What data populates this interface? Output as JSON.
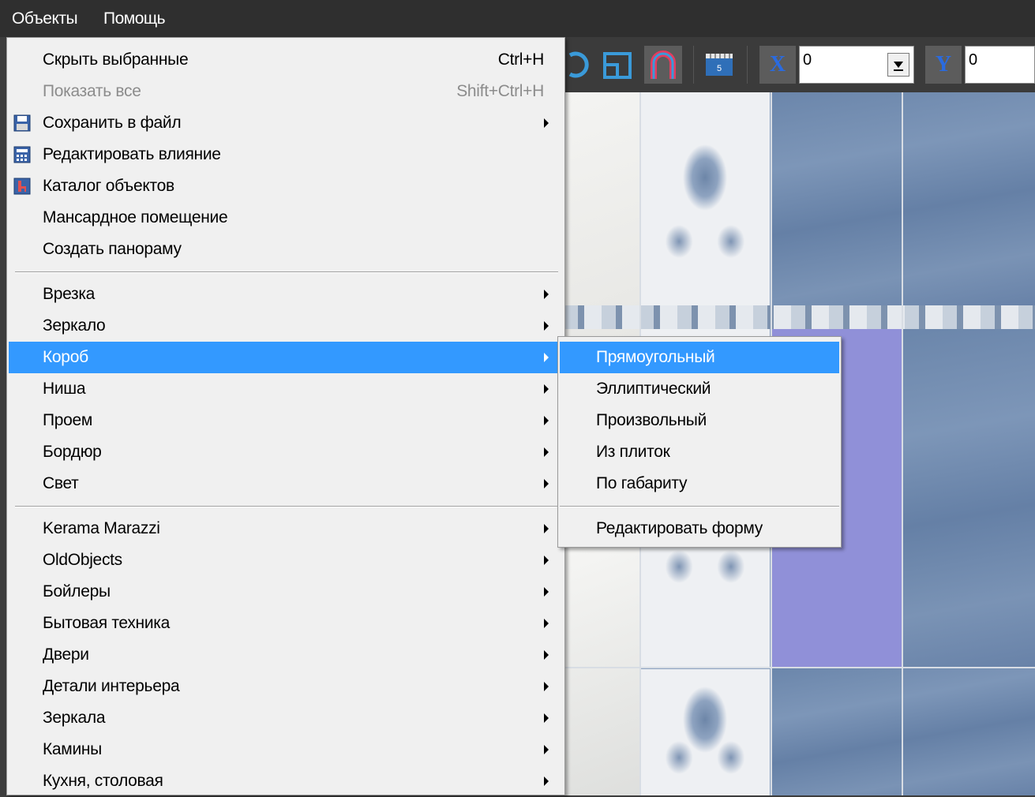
{
  "menubar": {
    "objects": "Объекты",
    "help": "Помощь"
  },
  "toolbar": {
    "x_label": "X",
    "x_value": "0",
    "y_label": "Y",
    "y_value": "0",
    "ruler_badge": "5"
  },
  "main_menu": {
    "hide_selected": {
      "label": "Скрыть выбранные",
      "shortcut": "Ctrl+H"
    },
    "show_all": {
      "label": "Показать все",
      "shortcut": "Shift+Ctrl+H"
    },
    "save_to_file": "Сохранить в файл",
    "edit_influence": "Редактировать влияние",
    "object_catalog": "Каталог объектов",
    "attic_room": "Мансардное помещение",
    "create_panorama": "Создать панораму",
    "insert": "Врезка",
    "mirror": "Зеркало",
    "box": "Короб",
    "niche": "Ниша",
    "opening": "Проем",
    "border": "Бордюр",
    "light": "Свет",
    "kerama_marazzi": "Kerama Marazzi",
    "old_objects": "OldObjects",
    "boilers": "Бойлеры",
    "appliances": "Бытовая техника",
    "doors": "Двери",
    "interior_details": "Детали интерьера",
    "mirrors": "Зеркала",
    "fireplaces": "Камины",
    "kitchen_dining": "Кухня, столовая"
  },
  "box_submenu": {
    "rectangular": "Прямоугольный",
    "elliptical": "Эллиптический",
    "arbitrary": "Произвольный",
    "from_tiles": "Из плиток",
    "by_dimensions": "По габариту",
    "edit_shape": "Редактировать форму"
  },
  "colors": {
    "highlight": "#3399ff",
    "menu_bg": "#f0f0f0",
    "menubar_bg": "#2f2f2f",
    "selected_tile": "#9090d8"
  }
}
